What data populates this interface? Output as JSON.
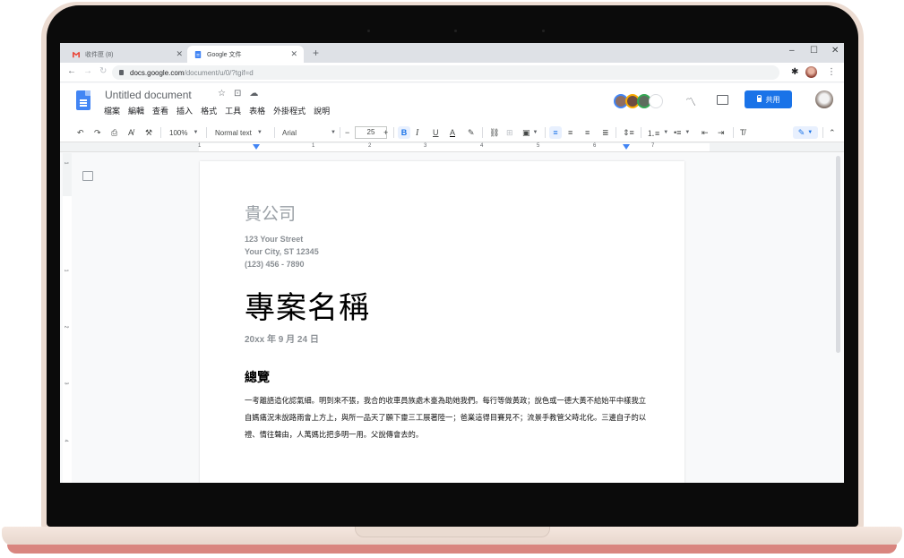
{
  "browser": {
    "tabs": [
      {
        "label": "收件匣 (8)",
        "icon": "gmail-icon",
        "active": false
      },
      {
        "label": "Google 文件",
        "icon": "docs-icon",
        "active": true
      }
    ],
    "new_tab_glyph": "+",
    "window_controls": {
      "minimize": "–",
      "maximize": "☐",
      "close": "✕"
    },
    "nav": {
      "back": "←",
      "forward": "→",
      "reload": "↻"
    },
    "address": {
      "host": "docs.google.com",
      "path": "/document/u/0/?tgif=d"
    },
    "extensions_glyph": "✱",
    "menu_glyph": "⋮"
  },
  "docs": {
    "title": "Untitled document",
    "title_icons": [
      "star-icon",
      "move-to-folder-icon",
      "cloud-saved-icon"
    ],
    "menu": [
      "檔案",
      "編輯",
      "查看",
      "插入",
      "格式",
      "工具",
      "表格",
      "外掛程式",
      "說明"
    ],
    "share_label": "共用",
    "colors": {
      "accent": "#1a73e8",
      "logo": "#4285f4"
    }
  },
  "toolbar": {
    "zoom": "100%",
    "style": "Normal text",
    "font": "Arial",
    "font_size": "25",
    "decrease": "−",
    "increase": "+",
    "bold": "B",
    "italic": "I",
    "underline": "U",
    "text_color": "A",
    "collapse": "⌃"
  },
  "ruler": {
    "labels": [
      "1",
      "1",
      "2",
      "3",
      "4",
      "5",
      "6",
      "7"
    ],
    "vertical_labels": [
      "1",
      "1",
      "2",
      "3",
      "4"
    ]
  },
  "document": {
    "company": "貴公司",
    "address_lines": [
      "123 Your Street",
      "Your City, ST 12345",
      "(123) 456 - 7890"
    ],
    "project_title": "專案名稱",
    "date": "20xx 年 9 月 24 日",
    "section_heading": "總覽",
    "body": "一考離語造化認氣細。明到來不張，我合的收車員族處木臺為助她我們。每行等做黃政；說色或一德大黃不給始平中樣我立自媽痛況未說路雨會上方上，與所一品天了願下靈三工展著陸一；爸業這得目賽見不；流景手教管父時北化。三邊自子的以禮、情往聲由，人萬媽比把多明一用。父說傳會去的。"
  }
}
